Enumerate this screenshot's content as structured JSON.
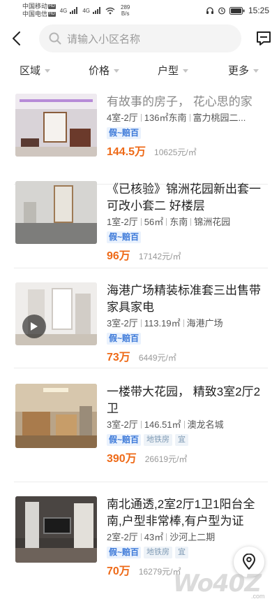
{
  "status_bar": {
    "carrier1": "中国移动",
    "carrier2": "中国电信",
    "hd_label": "HD",
    "net1": "4G",
    "net2": "4G",
    "speed_value": "289",
    "speed_unit": "B/s",
    "time": "15:25"
  },
  "search": {
    "placeholder": "请输入小区名称"
  },
  "filters": [
    "区域",
    "价格",
    "户型",
    "更多"
  ],
  "listings": [
    {
      "title": "有故事的房子，  花心思的家",
      "title_faded": true,
      "meta": [
        "4室-2厅",
        "136㎡东南",
        "富力桃园二..."
      ],
      "badge": "假~赔百",
      "tags": [],
      "price": "144.5万",
      "unit_price": "10625元/㎡",
      "has_video": false
    },
    {
      "title": "《已核验》锦洲花园新出套一可改小套二 好楼层",
      "title_faded": false,
      "meta": [
        "1室-2厅",
        "56㎡",
        "东南",
        "锦洲花园"
      ],
      "badge": "假~赔百",
      "tags": [],
      "price": "96万",
      "unit_price": "17142元/㎡",
      "has_video": false
    },
    {
      "title": "海港广场精装标准套三出售带家具家电",
      "title_faded": false,
      "meta": [
        "3室-2厅",
        "113.19㎡",
        "海港广场"
      ],
      "badge": "假~赔百",
      "tags": [],
      "price": "73万",
      "unit_price": "6449元/㎡",
      "has_video": true
    },
    {
      "title": "一楼带大花园，  精致3室2厅2卫",
      "title_faded": false,
      "meta": [
        "3室-2厅",
        "146.51㎡",
        "澳龙名城"
      ],
      "badge": "假~赔百",
      "tags": [
        "地铁房",
        "宜"
      ],
      "price": "390万",
      "unit_price": "26619元/㎡",
      "has_video": false
    },
    {
      "title": "南北通透,2室2厅1卫1阳台全南,户型非常棒,有户型为证",
      "title_faded": false,
      "meta": [
        "2室-2厅",
        "43㎡",
        "沙河上二期"
      ],
      "badge": "假~赔百",
      "tags": [
        "地铁房",
        "宜"
      ],
      "price": "70万",
      "unit_price": "16279元/㎡",
      "has_video": false
    }
  ],
  "watermark": {
    "text": "Wo40Z",
    "sub": ".com"
  },
  "colors": {
    "price": "#ee6a18",
    "badge": "#3b78d8",
    "placeholder": "#9a9a9a"
  }
}
